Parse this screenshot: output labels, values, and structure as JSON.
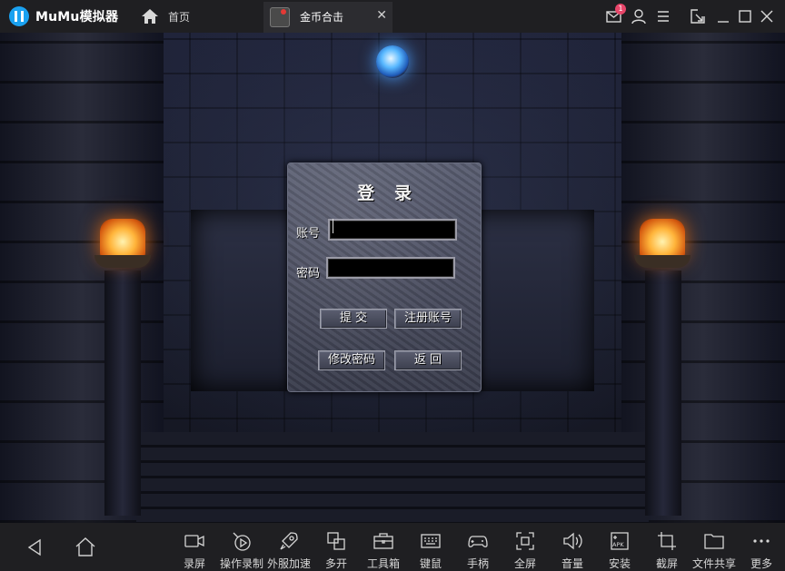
{
  "app": {
    "name": "MuMu模拟器",
    "home_tab_label": "首页",
    "active_tab_label": "金币合击",
    "mail_badge_count": "1"
  },
  "login": {
    "title": "登录",
    "account_label": "账号",
    "password_label": "密码",
    "account_value": "",
    "password_value": "",
    "submit_label": "提 交",
    "register_label": "注册账号",
    "change_password_label": "修改密码",
    "back_label": "返 回"
  },
  "toolbar": {
    "items": [
      {
        "label": "录屏",
        "icon": "video-camera-icon"
      },
      {
        "label": "操作录制",
        "icon": "record-operation-icon"
      },
      {
        "label": "外服加速",
        "icon": "rocket-icon"
      },
      {
        "label": "多开",
        "icon": "multi-window-icon"
      },
      {
        "label": "工具箱",
        "icon": "toolbox-icon"
      },
      {
        "label": "键鼠",
        "icon": "keyboard-icon"
      },
      {
        "label": "手柄",
        "icon": "gamepad-icon"
      },
      {
        "label": "全屏",
        "icon": "fullscreen-icon"
      },
      {
        "label": "音量",
        "icon": "volume-icon"
      },
      {
        "label": "安装",
        "icon": "apk-install-icon"
      },
      {
        "label": "截屏",
        "icon": "crop-screenshot-icon"
      },
      {
        "label": "文件共享",
        "icon": "folder-share-icon"
      },
      {
        "label": "更多",
        "icon": "more-dots-icon"
      }
    ]
  }
}
